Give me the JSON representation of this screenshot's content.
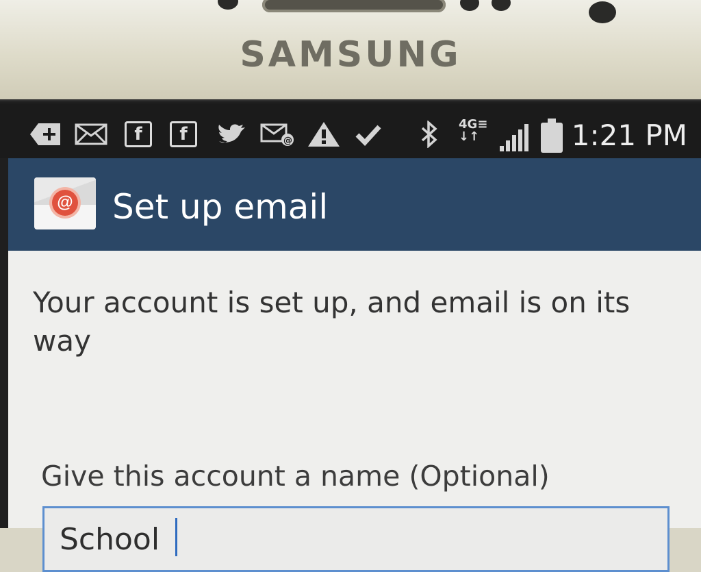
{
  "device": {
    "brand": "SAMSUNG"
  },
  "statusbar": {
    "icons": [
      "add-icon",
      "mail-icon",
      "facebook-icon",
      "facebook-icon",
      "twitter-icon",
      "mail-sync-icon",
      "warning-icon",
      "check-icon",
      "bluetooth-icon",
      "lte-icon",
      "signal-icon",
      "battery-icon"
    ],
    "network": "4G",
    "time": "1:21 PM"
  },
  "actionbar": {
    "title": "Set up email"
  },
  "main": {
    "message": "Your account is set up, and email is on its way",
    "account_name_label": "Give this account a name (Optional)",
    "account_name_value": "School"
  },
  "colors": {
    "actionbar": "#2b4766",
    "input_border": "#5d8fcf",
    "background": "#efefed"
  }
}
